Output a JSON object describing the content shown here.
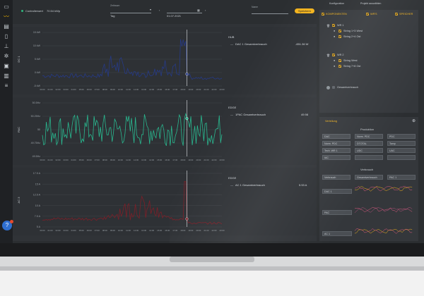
{
  "topbar": {
    "controller_label": "Controllerwert",
    "controller_value": "70.54 kWp",
    "period_label": "Zeitraum",
    "period_value": "Tag",
    "date_value": "01.07.2021",
    "name_label": "Name",
    "save_label": "Speichern"
  },
  "sidebar": {
    "items": [
      "dashboard",
      "chart",
      "pages",
      "doc",
      "plug",
      "gear",
      "layers",
      "list",
      "menu"
    ]
  },
  "panels": [
    {
      "id": "dc",
      "ylabel": "DC 1",
      "yticks": [
        "15 kW",
        "10 kW",
        "5 kW",
        "0 kW",
        "-5 kW"
      ],
      "info_title": "HUB",
      "info_label": "DAC 1 Gesamtverbrauch",
      "info_value": "-651.36 W",
      "color": "#263a86"
    },
    {
      "id": "ac",
      "ylabel": "PAC",
      "yticks": [
        "50.5Hz",
        "50.25Hz",
        "50",
        "49.75Hz",
        "49.5Hz"
      ],
      "info_title": "EDGE",
      "info_label": "1PAC Gesamtverbrauch",
      "info_value": "49.98",
      "color": "#29b88f"
    },
    {
      "id": "ac3",
      "ylabel": "AC 3",
      "yticks": [
        "17.5 A",
        "15 A",
        "12.5 A",
        "10 A",
        "7.5 A",
        "5 A"
      ],
      "info_title": "EDGE",
      "info_label": "AC 1 Gesamtverbrauch",
      "info_value": "5.53 A",
      "color": "#7c1f28"
    }
  ],
  "time_ticks": [
    "00:00",
    "01:00",
    "02:00",
    "03:00",
    "04:00",
    "05:00",
    "06:00",
    "07:00",
    "08:00",
    "09:00",
    "10:00",
    "11:00",
    "12:00",
    "13:00",
    "14:00",
    "15:00",
    "16:00",
    "17:00",
    "18:00",
    "19:00",
    "20:00",
    "21:00",
    "22:00",
    "23:00"
  ],
  "right": {
    "tab_config": "Konfiguration",
    "tab_project": "Projekt auswählen",
    "filter_components": "KOMPONENTEN",
    "filter_wrs": "WR'S",
    "filter_speicher": "SPEICHER",
    "tree": [
      {
        "label": "WR 1",
        "children": [
          "String 1+3 West",
          "String 2+4 Ost"
        ]
      },
      {
        "label": "WR 2",
        "children": [
          "String West",
          "String 7+8 Ost"
        ]
      }
    ],
    "total_label": "Gesamtverbrauch",
    "mc_title": "Verteilung",
    "producer_header": "Produktion",
    "producer_options": [
      "DAC",
      "Norm. PDC",
      "PDC",
      "Norm. PDC",
      "DTOTAL",
      "Tamp",
      "Tech. WR 1",
      "UDC",
      "UAC",
      "IAC",
      "",
      ""
    ],
    "consumer_header": "Verbrauch",
    "consumer_options": [
      "Verbrauch",
      "Gesamtverbrauch",
      "PAC 1"
    ],
    "mini_labels": [
      "DAC 1",
      "PAC",
      "AC 1"
    ],
    "help_label": "?"
  }
}
